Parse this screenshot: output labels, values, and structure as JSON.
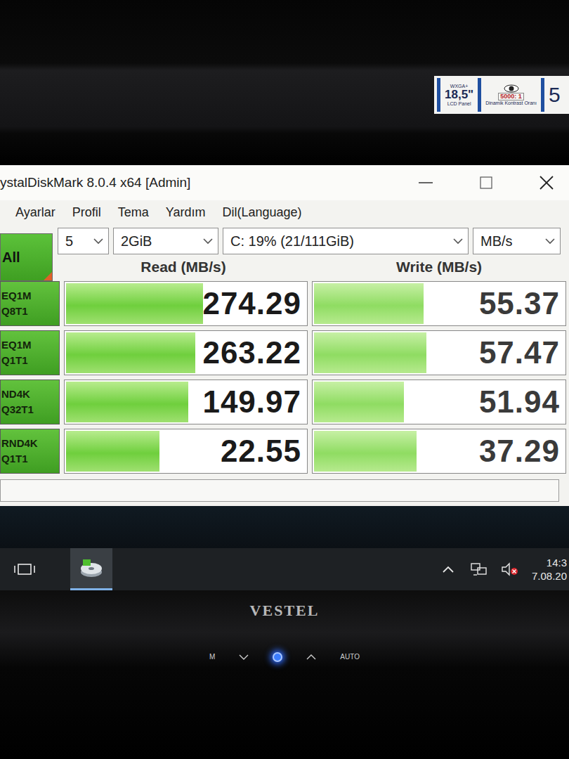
{
  "monitor": {
    "sticker": {
      "resolution": "WXGA+",
      "size": "18,5\"",
      "panel": "LCD Panel",
      "contrast": "5000: 1",
      "contrast_label": "Dinamik Kontrast Oranı",
      "cut": "5"
    },
    "brand": "VESTEL",
    "button_labels": [
      "M",
      "AUTO"
    ],
    "power_led_on": true
  },
  "window": {
    "title": "ystalDiskMark 8.0.4 x64 [Admin]"
  },
  "menu": [
    "Ayarlar",
    "Profil",
    "Tema",
    "Yardım",
    "Dil(Language)"
  ],
  "all_button": "All",
  "selects": [
    {
      "value": "5"
    },
    {
      "value": "2GiB"
    },
    {
      "value": "C: 19% (21/111GiB)"
    },
    {
      "value": "MB/s"
    }
  ],
  "columns": [
    "Read (MB/s)",
    "Write (MB/s)"
  ],
  "rows": [
    {
      "label": [
        "EQ1M",
        "Q8T1"
      ],
      "read": {
        "value": "274.29",
        "level": 0.57
      },
      "write": {
        "value": "55.37",
        "level": 0.44
      }
    },
    {
      "label": [
        "EQ1M",
        "Q1T1"
      ],
      "read": {
        "value": "263.22",
        "level": 0.54
      },
      "write": {
        "value": "57.47",
        "level": 0.45
      }
    },
    {
      "label": [
        "ND4K",
        "Q32T1"
      ],
      "read": {
        "value": "149.97",
        "level": 0.51
      },
      "write": {
        "value": "51.94",
        "level": 0.36
      }
    },
    {
      "label": [
        "RND4K",
        "Q1T1"
      ],
      "read": {
        "value": "22.55",
        "level": 0.39
      },
      "write": {
        "value": "37.29",
        "level": 0.41
      }
    }
  ],
  "taskbar": {
    "app_active": true,
    "volume_muted": true,
    "time": "14:3",
    "date": "7.08.20"
  }
}
